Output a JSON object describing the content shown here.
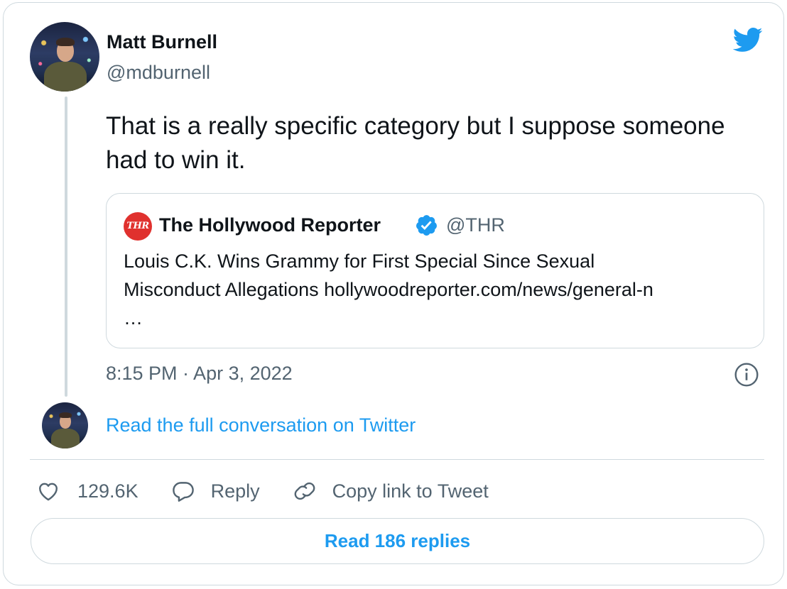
{
  "author": {
    "name": "Matt Burnell",
    "handle": "@mdburnell"
  },
  "tweet": {
    "text": "That is a really specific category but I suppose someone had to win it.",
    "timestamp": "8:15 PM · Apr 3, 2022"
  },
  "quoted_tweet": {
    "logo_text": "THR",
    "name": "The Hollywood Reporter",
    "handle": "@THR",
    "verified": true,
    "text_line1": "Louis C.K. Wins Grammy for First Special Since Sexual",
    "text_line2": "Misconduct Allegations hollywoodreporter.com/news/general-n",
    "text_line3": "…"
  },
  "conversation_link": "Read the full conversation on Twitter",
  "actions": {
    "like_count": "129.6K",
    "reply_label": "Reply",
    "copy_link_label": "Copy link to Tweet"
  },
  "read_replies_label": "Read 186 replies",
  "icons": {
    "brand": "twitter-bird-icon",
    "verified": "verified-badge-icon",
    "info": "info-icon",
    "like": "heart-icon",
    "reply": "speech-bubble-icon",
    "copy": "link-icon"
  },
  "colors": {
    "accent": "#1d9bf0",
    "text": "#0f1419",
    "muted": "#536471",
    "border": "#cfd9de",
    "thr_red": "#e0312e"
  }
}
